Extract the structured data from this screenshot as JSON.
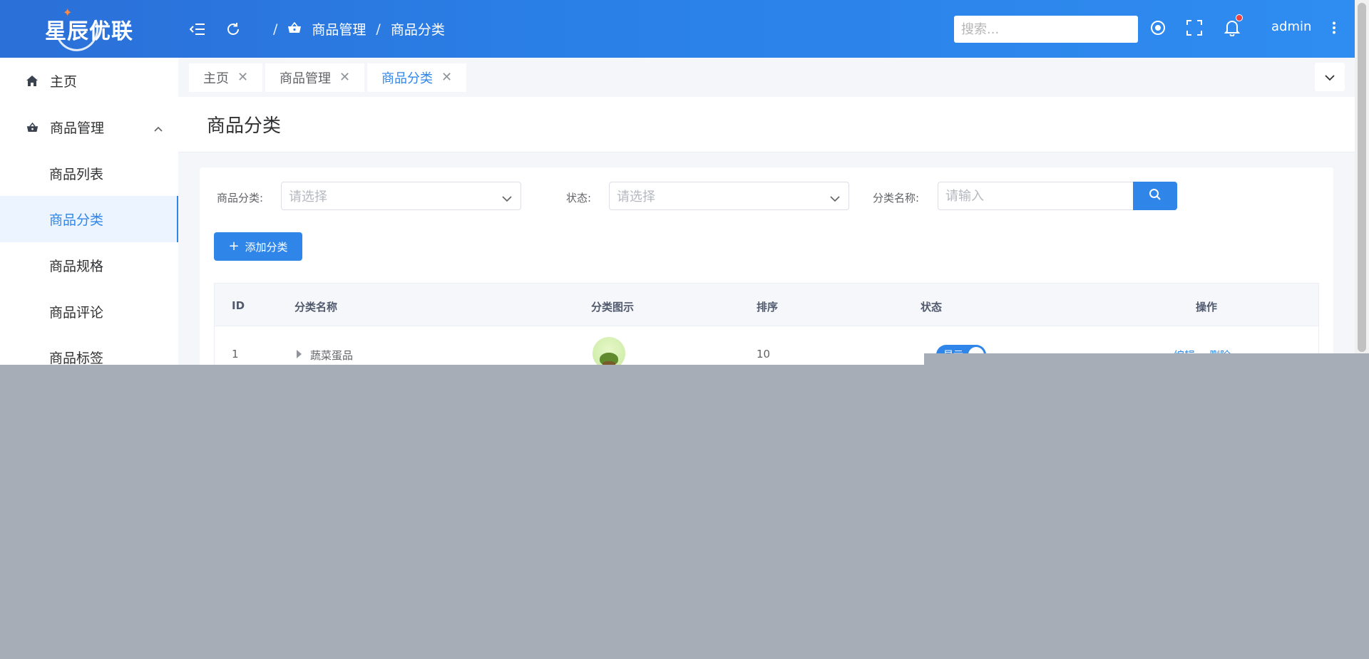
{
  "header": {
    "logo_text": "星辰优联",
    "breadcrumb": {
      "sep": "/",
      "parent": "商品管理",
      "current": "商品分类"
    },
    "search_placeholder": "搜索...",
    "user": "admin"
  },
  "sidebar": {
    "items": [
      {
        "label": "主页"
      },
      {
        "label": "商品管理"
      },
      {
        "label": "商品列表"
      },
      {
        "label": "商品分类"
      },
      {
        "label": "商品规格"
      },
      {
        "label": "商品评论"
      },
      {
        "label": "商品标签"
      }
    ]
  },
  "tabs": [
    {
      "label": "主页"
    },
    {
      "label": "商品管理"
    },
    {
      "label": "商品分类"
    }
  ],
  "page": {
    "title": "商品分类"
  },
  "filters": {
    "category_label": "商品分类:",
    "category_placeholder": "请选择",
    "status_label": "状态:",
    "status_placeholder": "请选择",
    "name_label": "分类名称:",
    "name_placeholder": "请输入"
  },
  "add_button": "添加分类",
  "table": {
    "columns": {
      "id": "ID",
      "name": "分类名称",
      "icon": "分类图示",
      "sort": "排序",
      "status": "状态",
      "ops": "操作"
    },
    "rows": [
      {
        "id": "1",
        "name": "蔬菜蛋品",
        "sort": "10",
        "status": "显示",
        "edit": "编辑",
        "delete": "删除"
      }
    ]
  },
  "colors": {
    "primary": "#2f86e8",
    "header_start": "#2b6fd8",
    "overlay": "#a6adb6",
    "badge": "#f04040"
  }
}
